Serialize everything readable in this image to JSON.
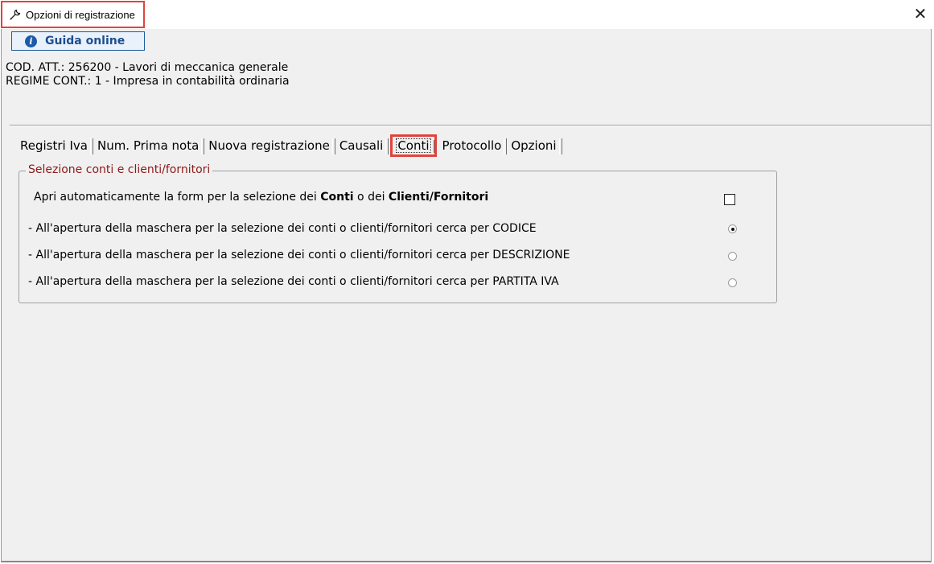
{
  "window": {
    "title": "Opzioni di registrazione",
    "close_label": "✕"
  },
  "toolbar": {
    "guida_label": "Guida online",
    "info_glyph": "i"
  },
  "header": {
    "cod_att": "COD. ATT.: 256200 - Lavori di meccanica generale",
    "regime": "REGIME CONT.: 1 - Impresa  in contabilità ordinaria"
  },
  "tabs": [
    {
      "label": "Registri Iva",
      "active": false
    },
    {
      "label": "Num. Prima nota",
      "active": false
    },
    {
      "label": "Nuova registrazione",
      "active": false
    },
    {
      "label": "Causali",
      "active": false
    },
    {
      "label": "Conti",
      "active": true
    },
    {
      "label": "Protocollo",
      "active": false
    },
    {
      "label": "Opzioni",
      "active": false
    }
  ],
  "group": {
    "legend": "Selezione conti e clienti/fornitori",
    "auto_open": {
      "prefix": "Apri automaticamente la form per la selezione dei ",
      "conti": "Conti",
      "middle": " o dei ",
      "clienti": "Clienti/Fornitori",
      "checked": false
    },
    "options": [
      {
        "label": "- All'apertura della maschera per la selezione dei conti o clienti/fornitori cerca per CODICE",
        "checked": true
      },
      {
        "label": "- All'apertura della maschera per la selezione dei conti o clienti/fornitori cerca per DESCRIZIONE",
        "checked": false
      },
      {
        "label": "- All'apertura della maschera per la selezione dei conti o clienti/fornitori cerca per PARTITA IVA",
        "checked": false
      }
    ]
  },
  "colors": {
    "highlight": "#e0443f",
    "legend_text": "#8b1a1a",
    "button_text": "#1d4f8e"
  }
}
